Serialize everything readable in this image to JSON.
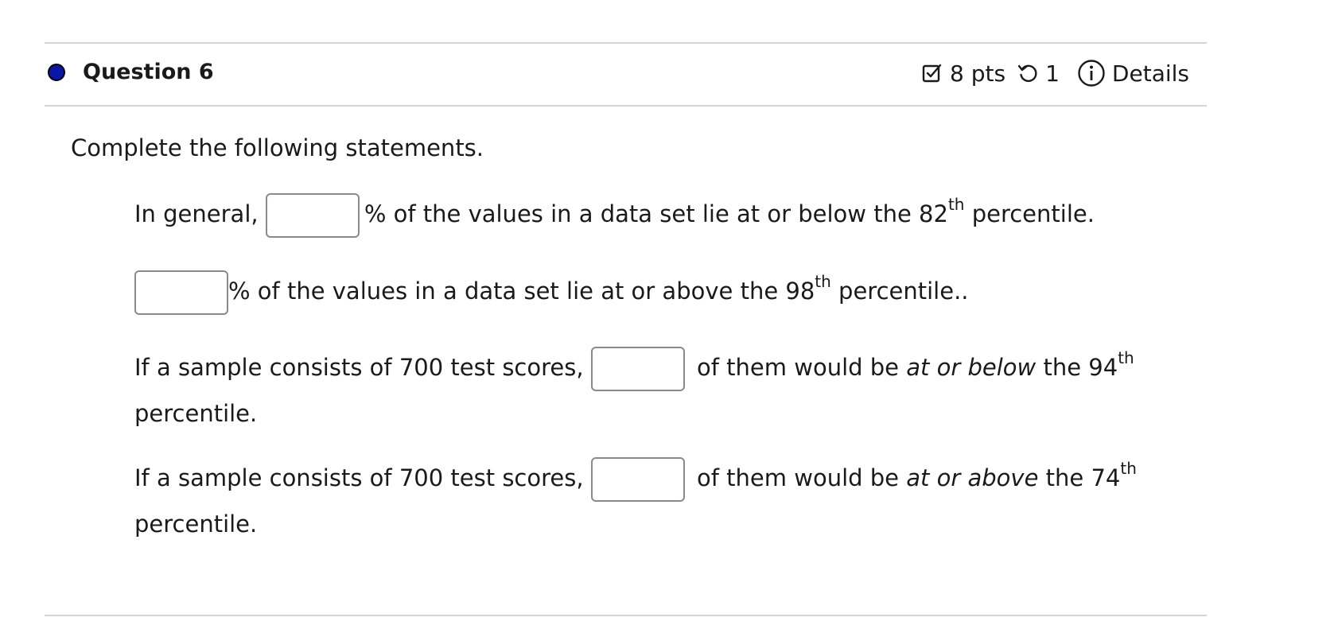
{
  "question": {
    "title": "Question 6",
    "points": "8 pts",
    "retries": "1",
    "details_label": "Details",
    "status_color": "#0a16a8"
  },
  "prompt": "Complete the following statements.",
  "statements": [
    {
      "before": "In general,",
      "after": "% of the values in a data set lie at or below the 82",
      "sup": "th",
      "end": " percentile."
    },
    {
      "before": "",
      "after": "% of the values in a data set lie at or above the 98",
      "sup": "th",
      "end": " percentile.."
    },
    {
      "before": "If a sample consists of 700 test scores,",
      "after_plain": "of them would be ",
      "after_emph": "at or below",
      "after_tail": " the 94",
      "sup": "th",
      "end": "percentile."
    },
    {
      "before": "If a sample consists of 700 test scores,",
      "after_plain": "of them would be ",
      "after_emph": "at or above",
      "after_tail": " the 74",
      "sup": "th",
      "end": "percentile."
    }
  ],
  "icons": {
    "points": "checkbox-edit-icon",
    "retries": "retry-icon",
    "details": "info-icon"
  }
}
